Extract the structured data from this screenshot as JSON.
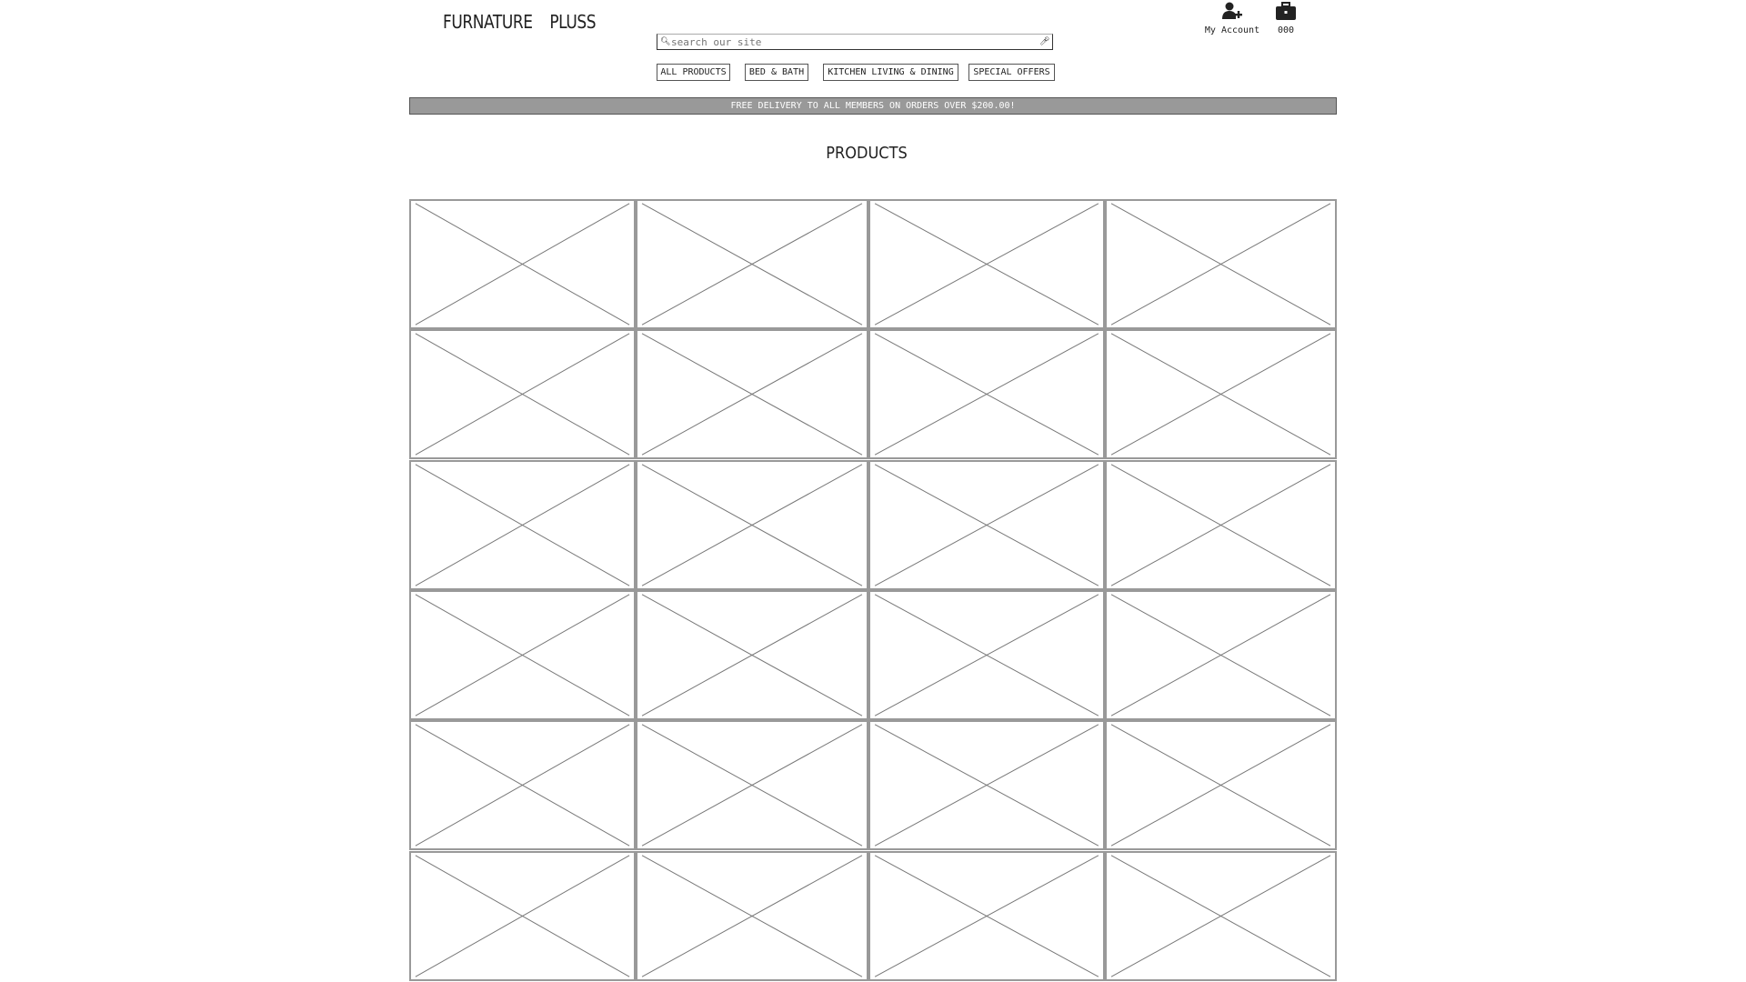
{
  "header": {
    "logo_word1": "FURNATURE",
    "logo_word2": "PLUSS",
    "search": {
      "placeholder": "search our site",
      "search_icon": "search-icon",
      "mic_icon": "microphone-icon"
    },
    "account": {
      "label": "My Account",
      "icon": "user-add-icon"
    },
    "cart": {
      "count": "000",
      "icon": "briefcase-icon"
    }
  },
  "nav": {
    "items": [
      {
        "label": "ALL PRODUCTS"
      },
      {
        "label": "BED & BATH"
      },
      {
        "label": "KITCHEN LIVING & DINING"
      },
      {
        "label": "SPECIAL OFFERS"
      }
    ]
  },
  "banner": {
    "text": "FREE DELIVERY TO ALL MEMBERS ON ORDERS OVER $200.00!"
  },
  "main": {
    "title": "PRODUCTS",
    "grid": {
      "rows": 6,
      "columns": 4
    }
  }
}
